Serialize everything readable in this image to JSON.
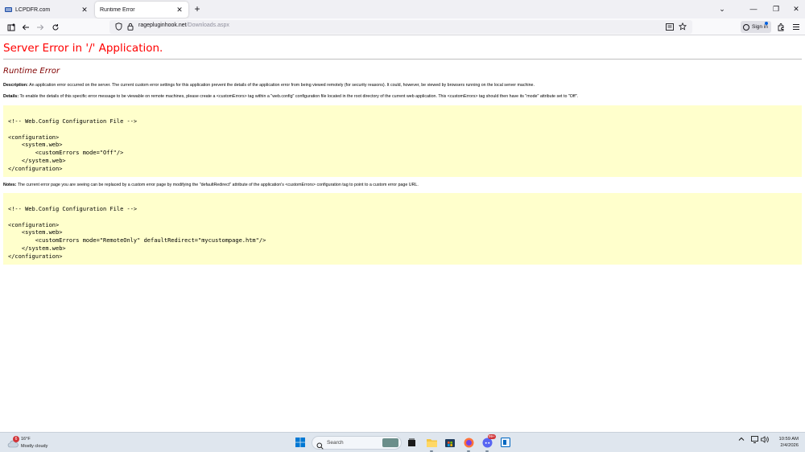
{
  "browser": {
    "tabs": [
      {
        "title": "LCPDFR.com",
        "close": "✕"
      },
      {
        "title": "Runtime Error",
        "close": "✕"
      }
    ],
    "new_tab": "+",
    "window_controls": {
      "list": "⌄",
      "minimize": "—",
      "restore": "❐",
      "close": "✕"
    },
    "url": {
      "host": "ragepluginhook.net",
      "path": "/Downloads.aspx"
    },
    "sign_in_label": "Sign in"
  },
  "page": {
    "title": "Server Error in '/' Application.",
    "subtitle": "Runtime Error",
    "description_label": "Description:",
    "description_text": " An application error occurred on the server. The current custom error settings for this application prevent the details of the application error from being viewed remotely (for security reasons). It could, however, be viewed by browsers running on the local server machine.",
    "details_label": "Details:",
    "details_text": " To enable the details of this specific error message to be viewable on remote machines, please create a <customErrors> tag within a \"web.config\" configuration file located in the root directory of the current web application. This <customErrors> tag should then have its \"mode\" attribute set to \"Off\".",
    "code_block_1": "<!-- Web.Config Configuration File -->\n\n<configuration>\n    <system.web>\n        <customErrors mode=\"Off\"/>\n    </system.web>\n</configuration>",
    "notes_label": "Notes:",
    "notes_text": " The current error page you are seeing can be replaced by a custom error page by modifying the \"defaultRedirect\" attribute of the application's <customErrors> configuration tag to point to a custom error page URL.",
    "code_block_2": "<!-- Web.Config Configuration File -->\n\n<configuration>\n    <system.web>\n        <customErrors mode=\"RemoteOnly\" defaultRedirect=\"mycustompage.htm\"/>\n    </system.web>\n</configuration>"
  },
  "taskbar": {
    "weather_badge": "6",
    "weather_temp": "16°F",
    "weather_desc": "Mostly cloudy",
    "search_label": "Search",
    "chat_badge": "99+",
    "clock_time": "10:59 AM",
    "clock_date": "2/4/2026"
  },
  "colors": {
    "error_title": "#ff0000",
    "error_subtitle": "#800000",
    "code_background": "#ffffcc"
  }
}
